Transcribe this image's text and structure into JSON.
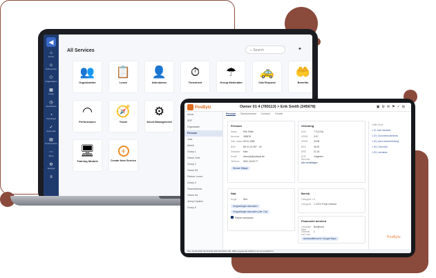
{
  "laptop": {
    "title": "All Services",
    "search_placeholder": "Search",
    "bell_icon": "bell-icon",
    "sidebar": [
      {
        "label": "Home",
        "icon": "home-icon",
        "glyph": "⌂"
      },
      {
        "label": "Self-service",
        "icon": "user-icon",
        "glyph": "☺"
      },
      {
        "label": "Organisation",
        "icon": "org-icon",
        "glyph": "⚇"
      },
      {
        "label": "Leave",
        "icon": "calendar-icon",
        "glyph": "▦"
      },
      {
        "label": "Attendance",
        "icon": "clock-icon",
        "glyph": "◷"
      },
      {
        "label": "Timesheet",
        "icon": "timesheet-icon",
        "glyph": "◔"
      },
      {
        "label": "Approvals",
        "icon": "check-icon",
        "glyph": "✓"
      },
      {
        "label": "Performance",
        "icon": "chart-icon",
        "glyph": "▤"
      },
      {
        "label": "More",
        "icon": "more-icon",
        "glyph": "⋯"
      },
      {
        "label": "Settings",
        "icon": "gear-icon",
        "glyph": "⚙"
      },
      {
        "label": "",
        "icon": "menu-icon",
        "glyph": "≡"
      }
    ],
    "tiles": [
      {
        "label": "Organization",
        "icon": "org-chart-icon",
        "glyph": "👥"
      },
      {
        "label": "Leave",
        "icon": "leave-icon",
        "glyph": "📋"
      },
      {
        "label": "Attendance",
        "icon": "attendance-icon",
        "glyph": "👤"
      },
      {
        "label": "Timesheet",
        "icon": "timesheet-tile-icon",
        "glyph": "⏱"
      },
      {
        "label": "Group Mediclaim",
        "icon": "umbrella-icon",
        "glyph": "☂"
      },
      {
        "label": "Cab Request",
        "icon": "taxi-icon",
        "glyph": "🚕"
      },
      {
        "label": "Benefits",
        "icon": "benefits-icon",
        "glyph": "🤲"
      },
      {
        "label": "Performance",
        "icon": "gauge-icon",
        "glyph": "◠"
      },
      {
        "label": "Travel",
        "icon": "travel-icon",
        "glyph": "🧭"
      },
      {
        "label": "Asset Management",
        "icon": "asset-icon",
        "glyph": "⚙"
      },
      {
        "label": "Training Module",
        "icon": "training-icon",
        "glyph": "🖥"
      },
      {
        "label": "Create New Service",
        "icon": "plus-icon",
        "glyph": "+"
      }
    ]
  },
  "tablet": {
    "brand": "PosBytz",
    "title": "Owner 01 4 (789113) > Erik Smith (345678)",
    "side_items": [
      "Home",
      "SDF",
      "Organisatie",
      "Persoon",
      "Jobs",
      "Admin",
      "Groep 1",
      "Owner Smit",
      "Groep 2",
      "Owner 99",
      "Partner Lorem",
      "Groep 3",
      "Geschiedenis",
      "Owner 9a",
      "Jenny Hopkins",
      "Groep 5"
    ],
    "tabs": [
      "Persoon",
      "Dienstverband",
      "Contract",
      "Functie"
    ],
    "person": {
      "heading": "Persoon",
      "rows": [
        {
          "k": "Naam",
          "v": "Erik Smith"
        },
        {
          "k": "Nummer",
          "v": "345678"
        },
        {
          "k": "Geb. datum",
          "v": "09.01.1980"
        },
        {
          "k": "BSN",
          "v": "BS 21.21.997 - 44"
        },
        {
          "k": "Geslacht",
          "v": "Man"
        },
        {
          "k": "Email",
          "v": "demo@@posbytz.de"
        },
        {
          "k": "Telefoon",
          "v": "0612-16.62.77"
        }
      ],
      "pill": "Nieuwe Bijlage"
    },
    "hours": {
      "heading": "Verloning",
      "rows": [
        {
          "k": "Uren",
          "v": "7.0 (0.04)"
        },
        {
          "k": "UREN",
          "v": "3.67"
        },
        {
          "k": "UREN",
          "v": "34.96"
        },
        {
          "k": "BRU",
          "v": "36.00"
        },
        {
          "k": "DRE",
          "v": "21.16"
        },
        {
          "k": "SOF Nummer",
          "v": "Volgeden"
        }
      ],
      "link": "Alle verlofdagen"
    },
    "status": {
      "heading": "Stat",
      "row": {
        "k": "Kopje",
        "v": "Niet"
      },
      "pills": [
        "Vergoedingen Aanvullen",
        "Vergoedingen Aanvullen (Ver. Ltd)"
      ],
      "check": "Partner werkzaam"
    },
    "extra": {
      "heading": "Bereik",
      "rows": [
        {
          "k": "Categorie 1",
          "v": "1"
        },
        {
          "k": "Categorie",
          "v": "1.3.674 9 Eye Huwerd"
        }
      ]
    },
    "finance": {
      "heading": "Financiele bereked",
      "rows": [
        {
          "k": "Geworkte Rate",
          "v": "Berijfhoed"
        },
        {
          "k": "Gewerkt incl Loon",
          "v": "1"
        }
      ],
      "pill": "Aanschaffenvan in Google Maps"
    },
    "right_panel": [
      "Leftis Hoss",
      "1.22 Jaar Vandiete",
      "1.20 | Documentchiedenis",
      "1.30 | Alert Jaarverbruiking",
      "1.30 | Overzicht",
      "1.30 | vertraisie"
    ],
    "statusbar": "Pos: 19-05-2020 09:30   EUR 189.19   ROOS 192, 9881   payperiode 2025.01 nnn   tnt-solnaIZ.0.4"
  }
}
